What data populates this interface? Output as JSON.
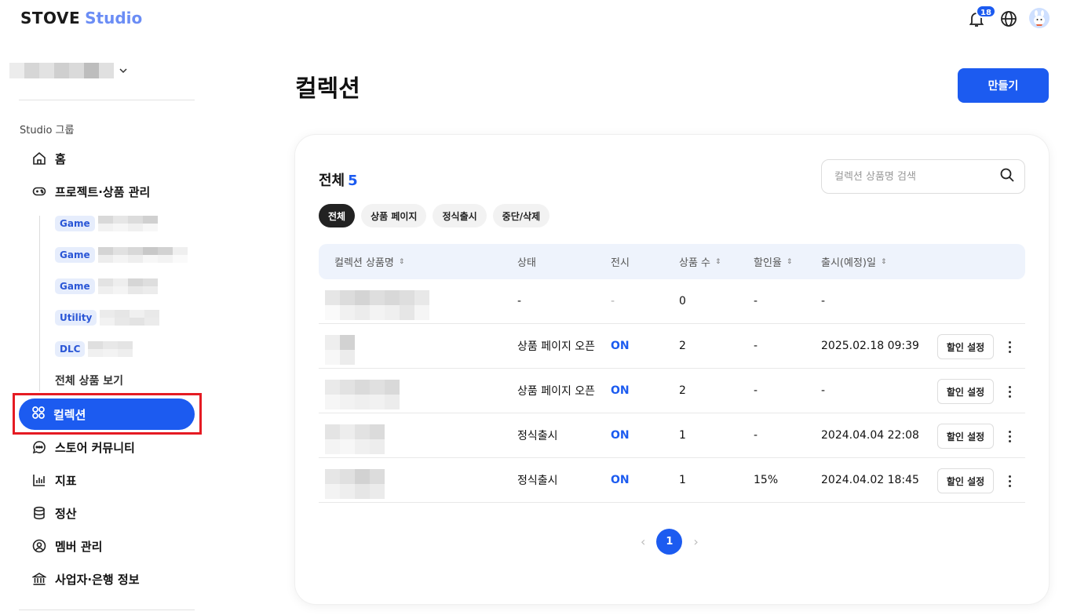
{
  "header": {
    "logo_stove": "STOVE",
    "logo_studio": "Studio",
    "notification_count": "18",
    "icons": [
      "bell-icon",
      "globe-icon",
      "avatar"
    ]
  },
  "sidebar": {
    "group_label": "Studio 그룹",
    "nav": [
      {
        "label": "홈",
        "icon": "home-icon"
      },
      {
        "label": "프로젝트·상품 관리",
        "icon": "gamepad-icon"
      },
      {
        "label": "컬렉션",
        "icon": "collection-icon",
        "active": true
      },
      {
        "label": "스토어 커뮤니티",
        "icon": "chat-icon"
      },
      {
        "label": "지표",
        "icon": "chart-icon"
      },
      {
        "label": "정산",
        "icon": "coins-icon"
      },
      {
        "label": "멤버 관리",
        "icon": "member-icon"
      },
      {
        "label": "사업자·은행 정보",
        "icon": "bank-icon"
      }
    ],
    "sub_items": [
      {
        "tag": "Game"
      },
      {
        "tag": "Game"
      },
      {
        "tag": "Game"
      },
      {
        "tag": "Utility"
      },
      {
        "tag": "DLC"
      }
    ],
    "all_products": "전체 상품 보기"
  },
  "main": {
    "title": "컬렉션",
    "create_button": "만들기",
    "count_label": "전체",
    "count_value": "5",
    "search_placeholder": "컬렉션 상품명 검색",
    "filters": [
      "전체",
      "상품 페이지",
      "정식출시",
      "중단/삭제"
    ],
    "columns": [
      "컬렉션 상품명",
      "상태",
      "전시",
      "상품 수",
      "할인율",
      "출시(예정)일"
    ],
    "rows": [
      {
        "status": "-",
        "display": "-",
        "count": "0",
        "discount": "-",
        "date": "-",
        "action": ""
      },
      {
        "status": "상품 페이지 오픈",
        "display": "ON",
        "count": "2",
        "discount": "-",
        "date": "2025.02.18 09:39",
        "action": "할인 설정"
      },
      {
        "status": "상품 페이지 오픈",
        "display": "ON",
        "count": "2",
        "discount": "-",
        "date": "-",
        "action": "할인 설정"
      },
      {
        "status": "정식출시",
        "display": "ON",
        "count": "1",
        "discount": "-",
        "date": "2024.04.04 22:08",
        "action": "할인 설정"
      },
      {
        "status": "정식출시",
        "display": "ON",
        "count": "1",
        "discount": "15%",
        "date": "2024.04.02 18:45",
        "action": "할인 설정"
      }
    ],
    "pagination": {
      "current": "1"
    }
  },
  "colors": {
    "accent": "#1c5bf0",
    "highlight_border": "#e51b23"
  }
}
